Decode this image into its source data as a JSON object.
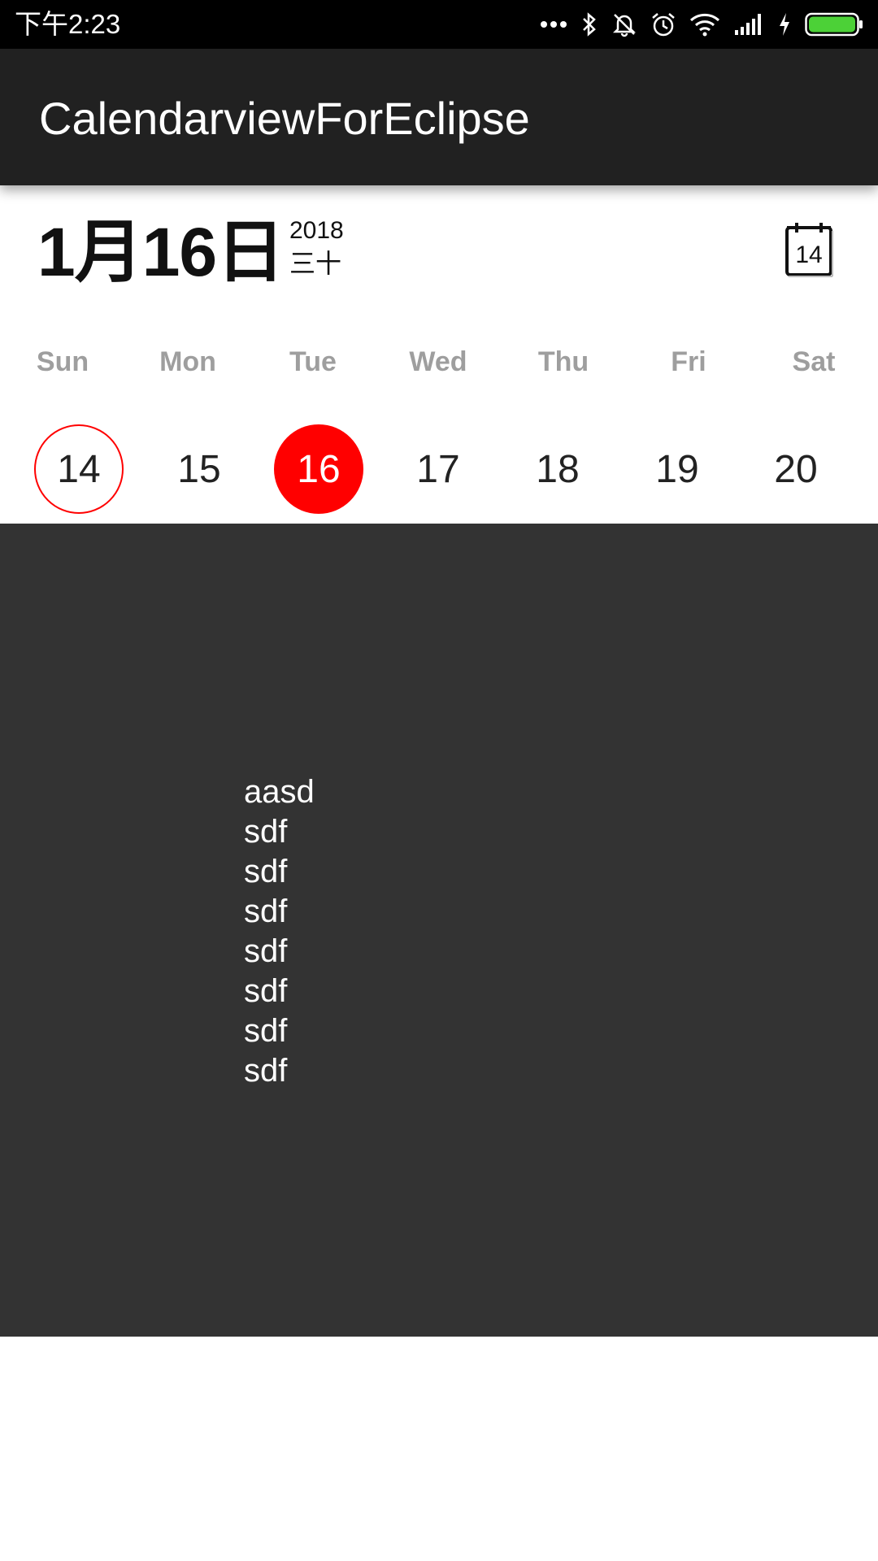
{
  "status_bar": {
    "time": "下午2:23",
    "icons": [
      "more-dots-icon",
      "bluetooth-icon",
      "mute-icon",
      "alarm-icon",
      "wifi-icon",
      "signal-icon",
      "charging-icon",
      "battery-icon"
    ],
    "battery_color": "#4cd137"
  },
  "app_bar": {
    "title": "CalendarviewForEclipse",
    "background": "#212121"
  },
  "date_header": {
    "date": "1月16日",
    "year": "2018",
    "lunar": "三十",
    "today_icon_number": "14"
  },
  "week": {
    "weekdays": [
      "Sun",
      "Mon",
      "Tue",
      "Wed",
      "Thu",
      "Fri",
      "Sat"
    ],
    "days": [
      "14",
      "15",
      "16",
      "17",
      "18",
      "19",
      "20"
    ],
    "today_index": 0,
    "selected_index": 2,
    "accent_color": "#ff0000"
  },
  "content": {
    "background": "#333333",
    "lines": [
      "aasd",
      "sdf",
      "sdf",
      "sdf",
      "sdf",
      "sdf",
      "sdf",
      "sdf"
    ]
  }
}
